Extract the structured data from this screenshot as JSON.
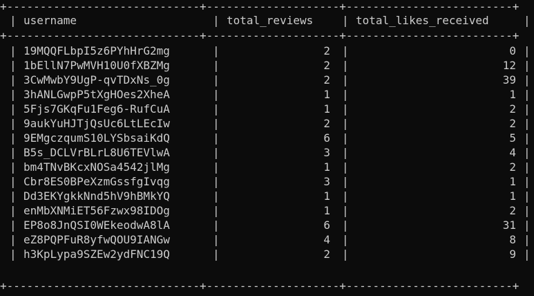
{
  "terminal": {
    "border_line": "+-----------------------------+--------------------+-------------------------+",
    "separator": "|",
    "header": {
      "col1": "username",
      "col2": "total_reviews",
      "col3": "total_likes_received"
    },
    "rows": [
      {
        "username": "19MQQFLbpI5z6PYhHrG2mg",
        "total_reviews": "2",
        "total_likes_received": "0"
      },
      {
        "username": "1bEllN7PwMVH10U0fXBZMg",
        "total_reviews": "2",
        "total_likes_received": "12"
      },
      {
        "username": "3CwMwbY9UgP-qvTDxNs_0g",
        "total_reviews": "2",
        "total_likes_received": "39"
      },
      {
        "username": "3hANLGwpP5tXgHOes2XheA",
        "total_reviews": "1",
        "total_likes_received": "1"
      },
      {
        "username": "5Fjs7GKqFu1Feg6-RufCuA",
        "total_reviews": "1",
        "total_likes_received": "2"
      },
      {
        "username": "9aukYuHJTjQsUc6LtLEcIw",
        "total_reviews": "2",
        "total_likes_received": "2"
      },
      {
        "username": "9EMgczqumS10LYSbsaiKdQ",
        "total_reviews": "6",
        "total_likes_received": "5"
      },
      {
        "username": "B5s_DCLVrBLrL8U6TEVlwA",
        "total_reviews": "3",
        "total_likes_received": "4"
      },
      {
        "username": "bm4TNvBKcxNOSa4542jlMg",
        "total_reviews": "1",
        "total_likes_received": "2"
      },
      {
        "username": "Cbr8ES0BPeXzmGssfgIvqg",
        "total_reviews": "3",
        "total_likes_received": "1"
      },
      {
        "username": "Dd3EKYgkkNnd5hV9hBMkYQ",
        "total_reviews": "1",
        "total_likes_received": "1"
      },
      {
        "username": "enMbXNMiET56Fzwx98IDOg",
        "total_reviews": "1",
        "total_likes_received": "2"
      },
      {
        "username": "EP8o8JnQSI0WEkeodwA8lA",
        "total_reviews": "6",
        "total_likes_received": "31"
      },
      {
        "username": "eZ8PQPFuR8yfwQOU9IANGw",
        "total_reviews": "4",
        "total_likes_received": "8"
      },
      {
        "username": "h3KpLypa9SZEw2ydFNC19Q",
        "total_reviews": "2",
        "total_likes_received": "9"
      }
    ]
  }
}
